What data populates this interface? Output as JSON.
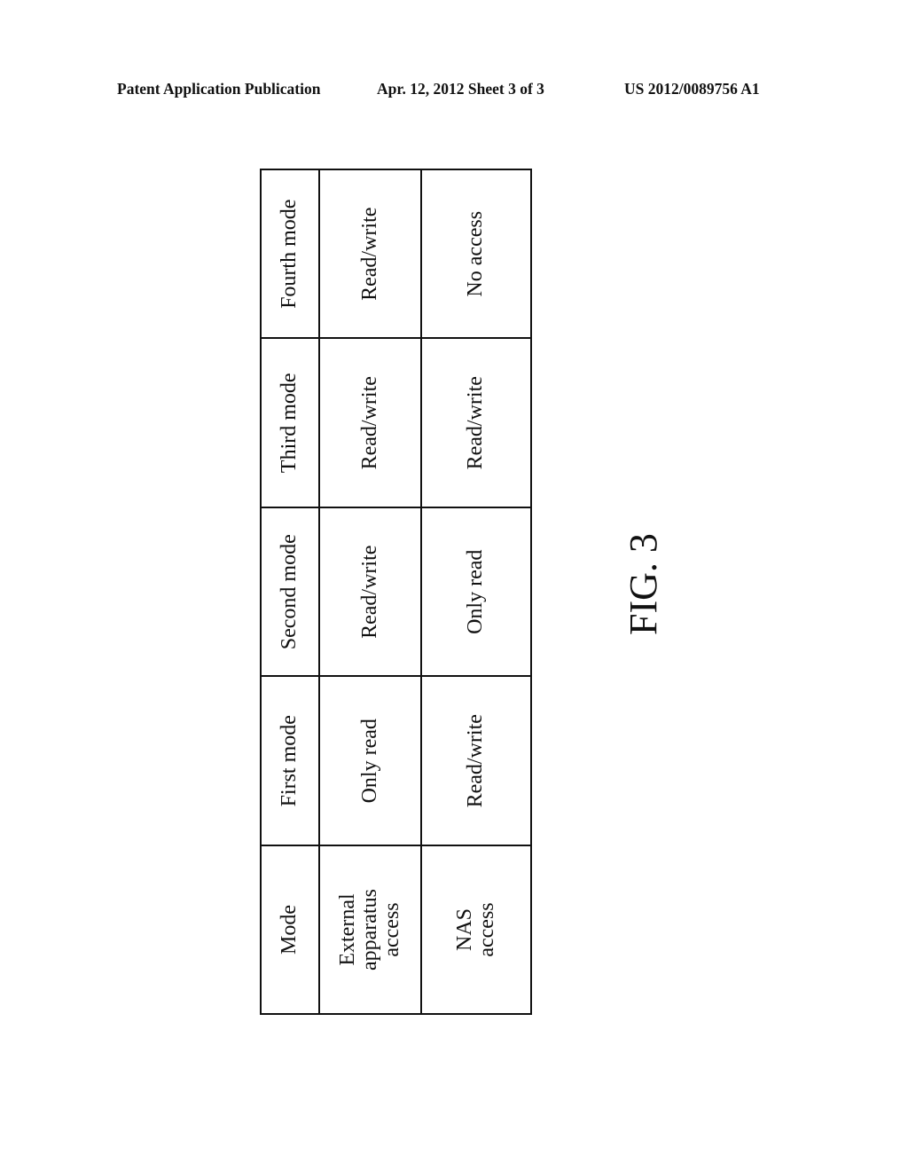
{
  "header": {
    "publication_label": "Patent Application Publication",
    "date_sheet": "Apr. 12, 2012  Sheet 3 of 3",
    "patent_number": "US 2012/0089756 A1"
  },
  "table": {
    "columns": [
      "Mode",
      "External\napparatus\naccess",
      "NAS\naccess"
    ],
    "rows": [
      {
        "mode": "First mode",
        "external_apparatus_access": "Only read",
        "nas_access": "Read/write"
      },
      {
        "mode": "Second mode",
        "external_apparatus_access": "Read/write",
        "nas_access": "Only read"
      },
      {
        "mode": "Third mode",
        "external_apparatus_access": "Read/write",
        "nas_access": "Read/write"
      },
      {
        "mode": "Fourth mode",
        "external_apparatus_access": "Read/write",
        "nas_access": "No access"
      }
    ]
  },
  "figure_label": "FIG. 3"
}
